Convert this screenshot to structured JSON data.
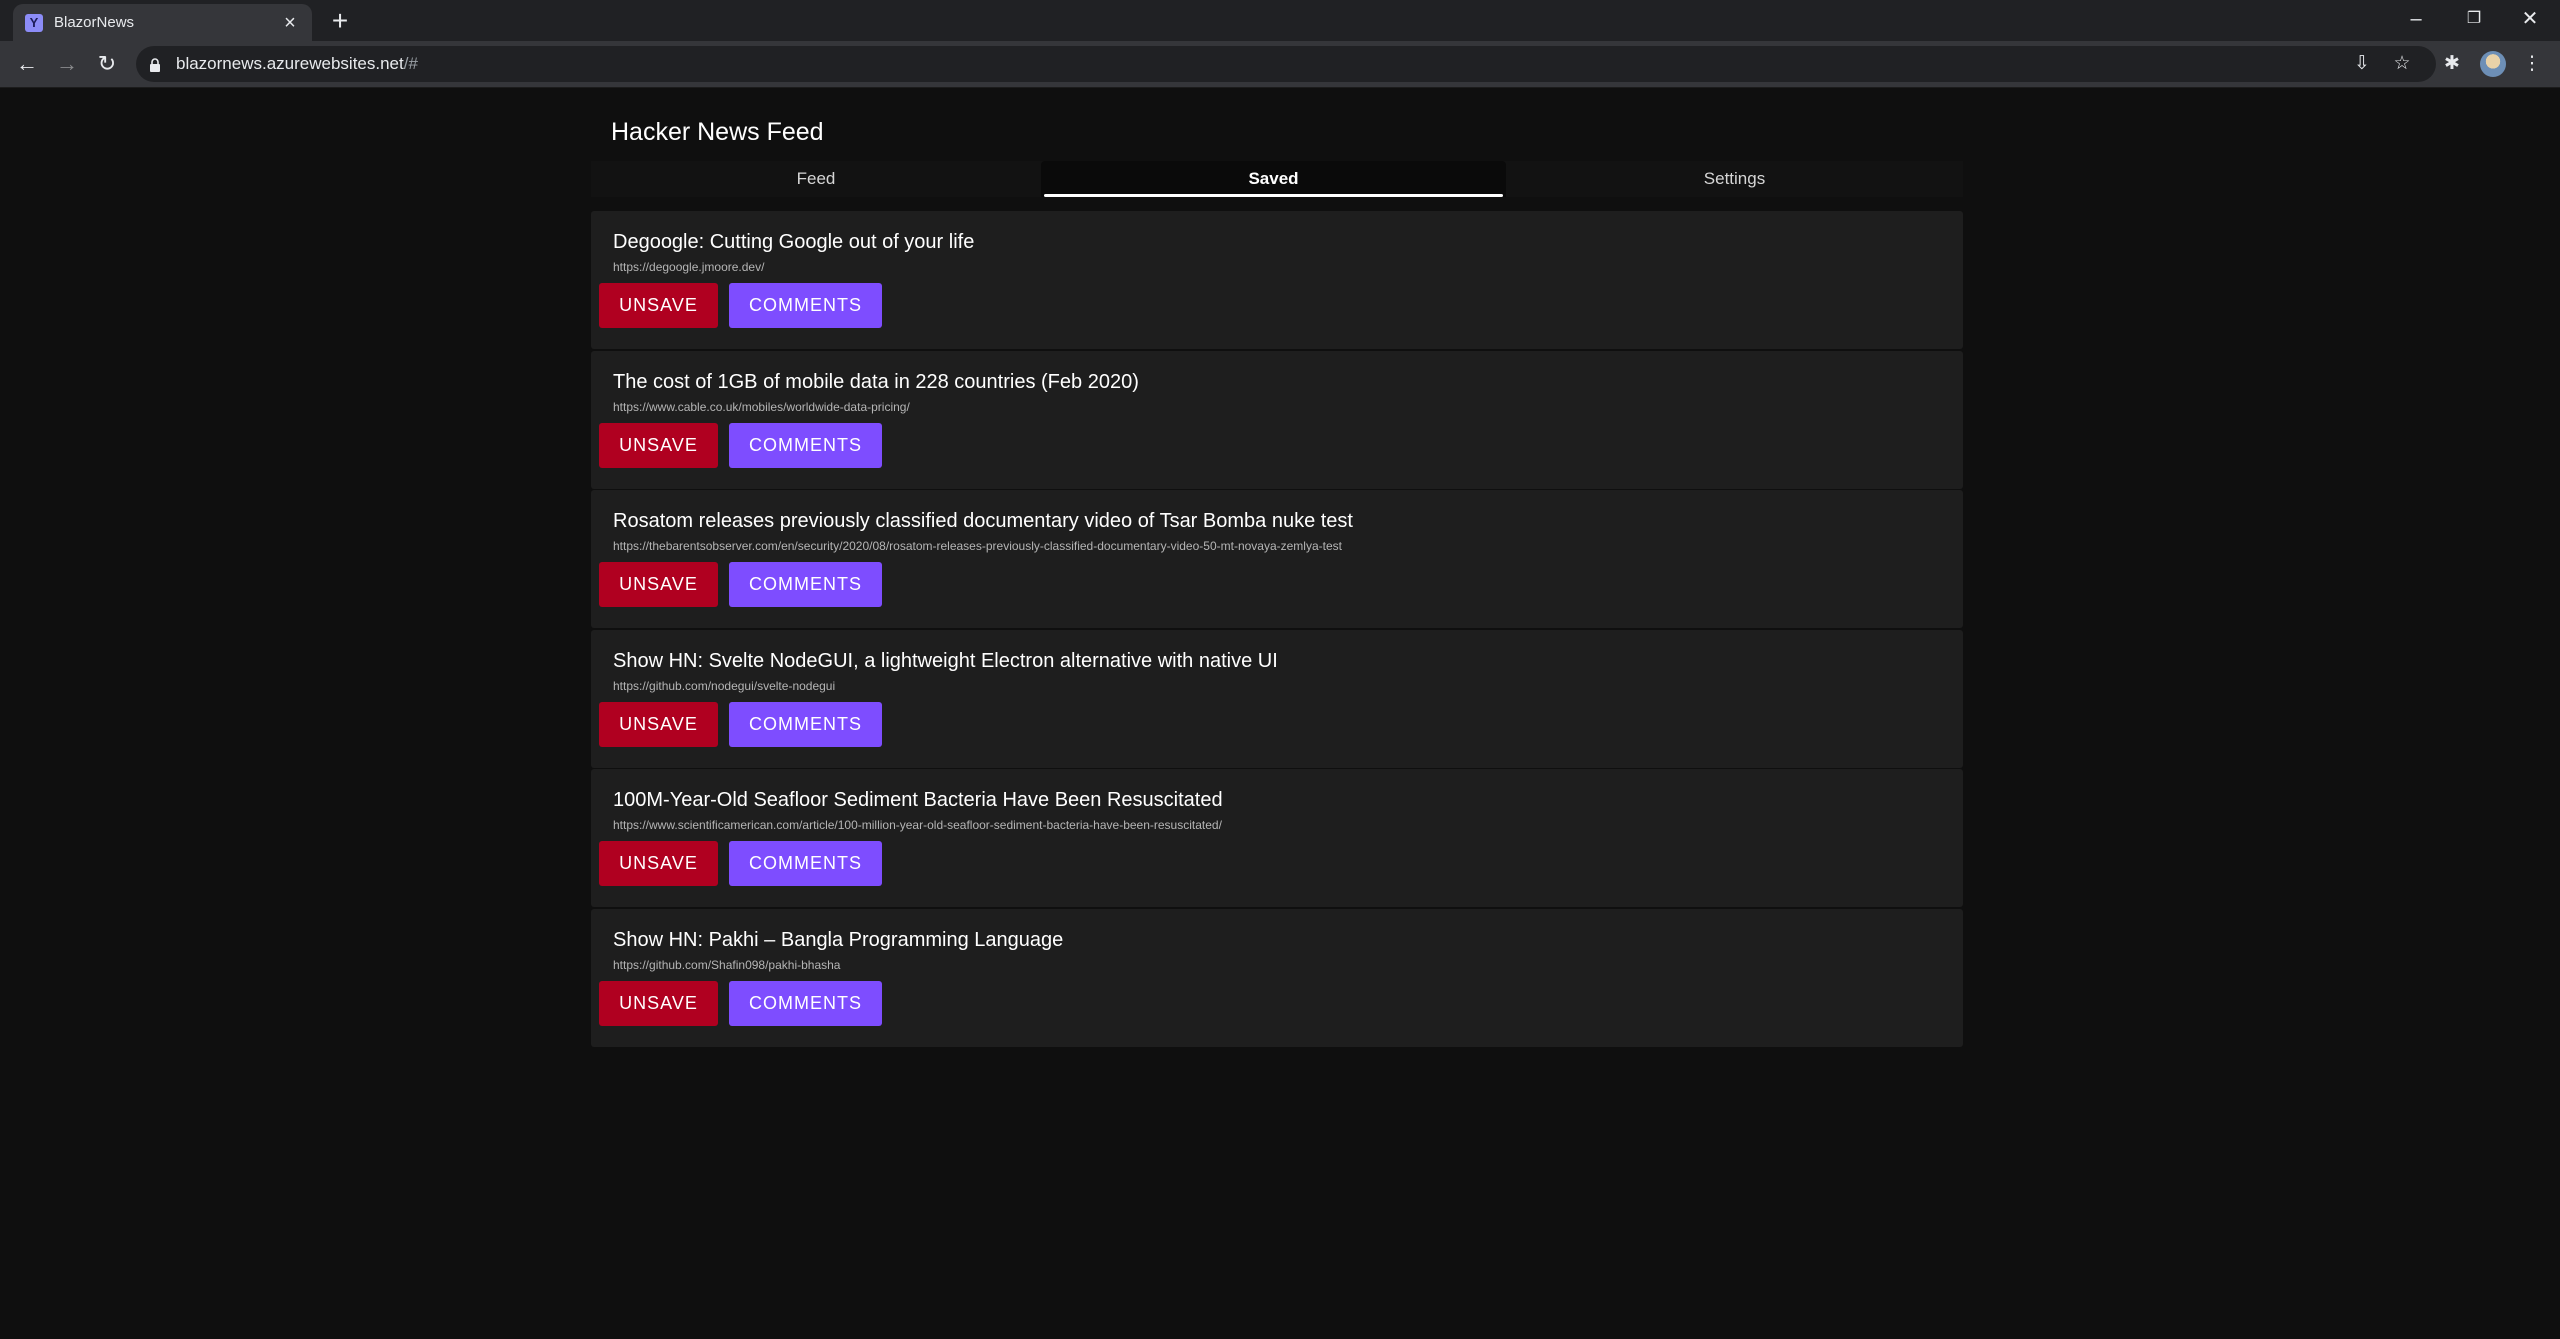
{
  "browser": {
    "tab_title": "BlazorNews",
    "favicon_letter": "Y",
    "url_host": "blazornews.azurewebsites.net",
    "url_rest": "/#"
  },
  "app": {
    "title": "Hacker News Feed",
    "tabs": [
      {
        "label": "Feed"
      },
      {
        "label": "Saved"
      },
      {
        "label": "Settings"
      }
    ]
  },
  "buttons": {
    "unsave": "UNSAVE",
    "comments": "COMMENTS"
  },
  "stories": [
    {
      "title": "Degoogle: Cutting Google out of your life",
      "url": "https://degoogle.jmoore.dev/"
    },
    {
      "title": "The cost of 1GB of mobile data in 228 countries (Feb 2020)",
      "url": "https://www.cable.co.uk/mobiles/worldwide-data-pricing/"
    },
    {
      "title": "Rosatom releases previously classified documentary video of Tsar Bomba nuke test",
      "url": "https://thebarentsobserver.com/en/security/2020/08/rosatom-releases-previously-classified-documentary-video-50-mt-novaya-zemlya-test"
    },
    {
      "title": "Show HN: Svelte NodeGUI, a lightweight Electron alternative with native UI",
      "url": "https://github.com/nodegui/svelte-nodegui"
    },
    {
      "title": "100M-Year-Old Seafloor Sediment Bacteria Have Been Resuscitated",
      "url": "https://www.scientificamerican.com/article/100-million-year-old-seafloor-sediment-bacteria-have-been-resuscitated/"
    },
    {
      "title": "Show HN: Pakhi – Bangla Programming Language",
      "url": "https://github.com/Shafin098/pakhi-bhasha"
    }
  ]
}
